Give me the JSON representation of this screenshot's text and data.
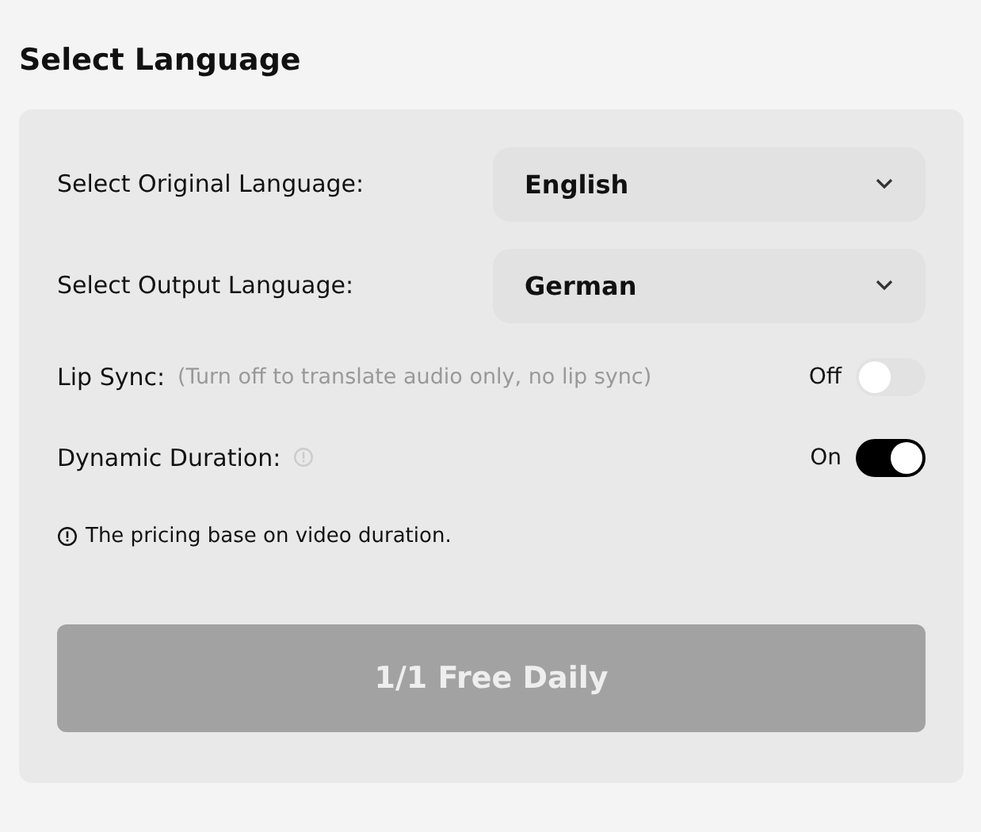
{
  "title": "Select Language",
  "selects": [
    {
      "label": "Select Original Language:",
      "value": "English"
    },
    {
      "label": "Select Output Language:",
      "value": "German"
    }
  ],
  "toggles": [
    {
      "label": "Lip Sync:",
      "hint": "(Turn off to translate audio only, no lip sync)",
      "info": false,
      "state_label": "Off",
      "on": false
    },
    {
      "label": "Dynamic Duration:",
      "info": true,
      "state_label": "On",
      "on": true
    }
  ],
  "note": "The pricing base on video duration.",
  "button": {
    "label": "1/1 Free Daily",
    "disabled": true
  }
}
